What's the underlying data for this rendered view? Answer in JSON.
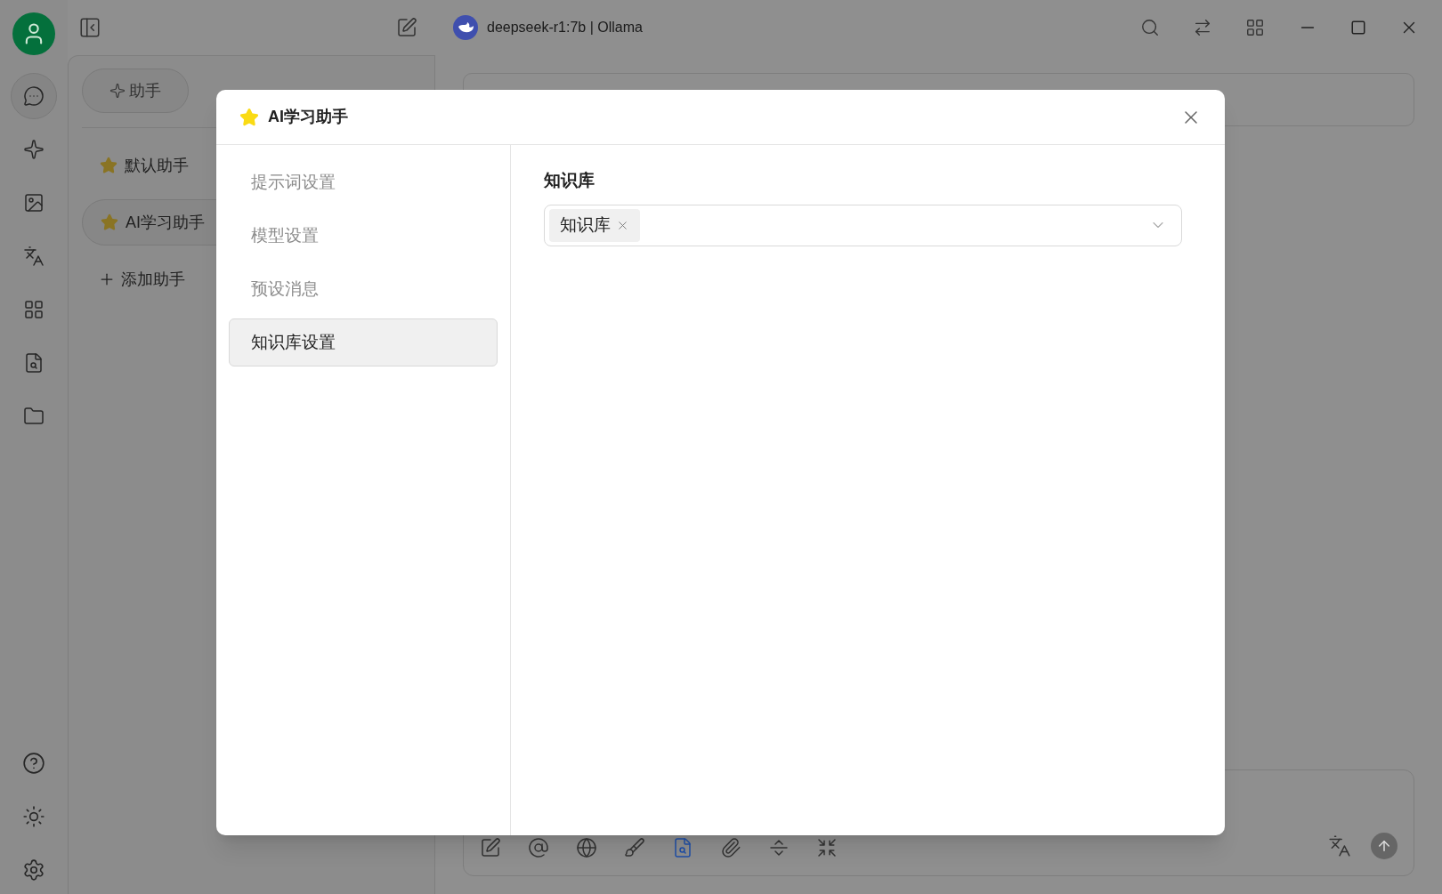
{
  "titlebar": {
    "model": "deepseek-r1:7b | Ollama"
  },
  "nav": [
    {
      "kind": "chat",
      "selected": true
    },
    {
      "kind": "sparkle",
      "selected": false
    },
    {
      "kind": "image",
      "selected": false
    },
    {
      "kind": "translate",
      "selected": false
    },
    {
      "kind": "apps",
      "selected": false
    },
    {
      "kind": "knowledge",
      "selected": false
    },
    {
      "kind": "files",
      "selected": false
    }
  ],
  "assistant_tabs": [
    {
      "label": "助手",
      "selected": true
    }
  ],
  "assistants": [
    {
      "name": "默认助手",
      "selected": false
    },
    {
      "name": "AI学习助手",
      "selected": true
    }
  ],
  "add_assistant": "添加助手",
  "input_tools": [
    {
      "kind": "edit",
      "active": false
    },
    {
      "kind": "mention",
      "active": false
    },
    {
      "kind": "web",
      "active": false
    },
    {
      "kind": "clear",
      "active": false
    },
    {
      "kind": "knowledge",
      "active": true
    },
    {
      "kind": "attach",
      "active": false
    },
    {
      "kind": "divider",
      "active": false
    },
    {
      "kind": "expand",
      "active": false
    }
  ],
  "dialog": {
    "title": "AI学习助手",
    "menu": [
      {
        "label": "提示词设置",
        "selected": false
      },
      {
        "label": "模型设置",
        "selected": false
      },
      {
        "label": "预设消息",
        "selected": false
      },
      {
        "label": "知识库设置",
        "selected": true
      }
    ],
    "section_title": "知识库",
    "selected_tags": [
      "知识库"
    ]
  }
}
